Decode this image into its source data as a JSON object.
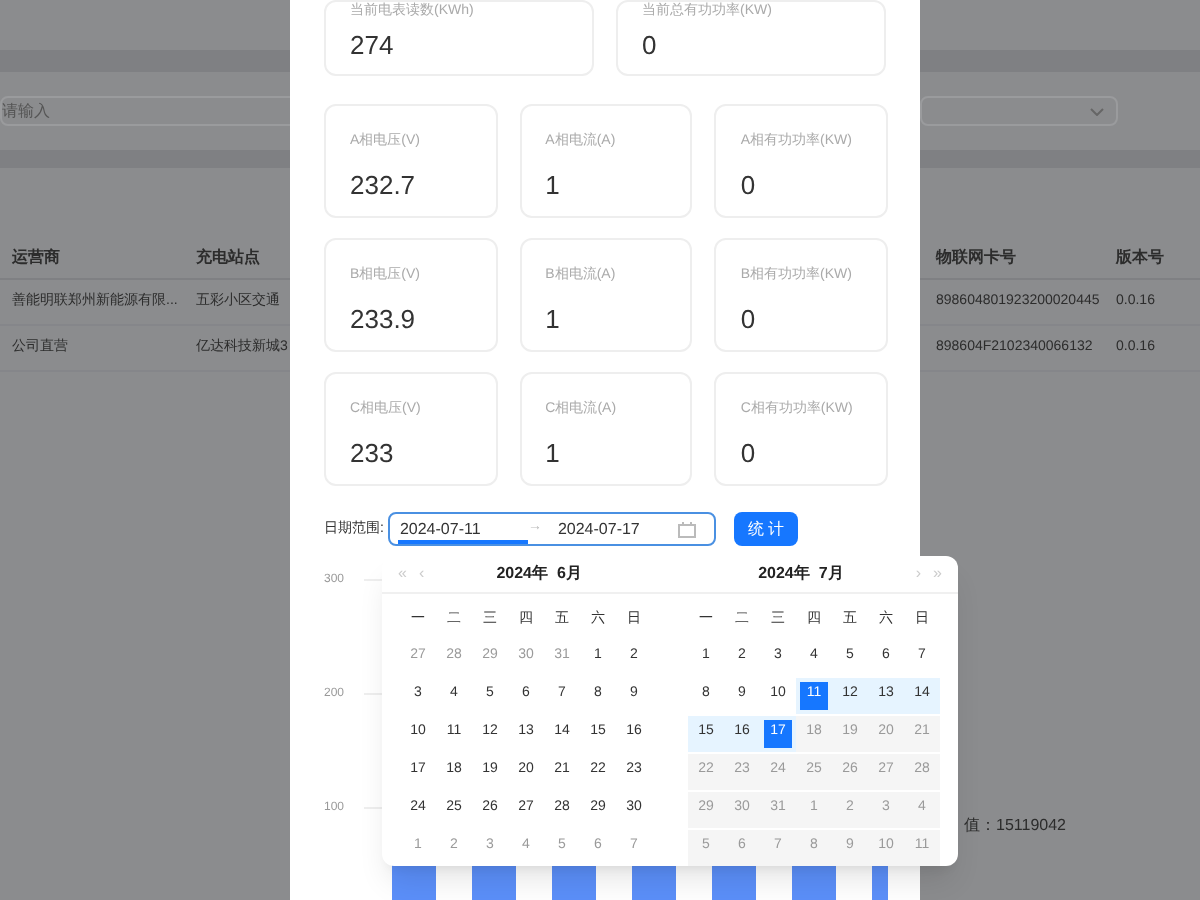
{
  "background": {
    "search_placeholder": "请输入",
    "table": {
      "columns_left": [
        "运营商",
        "充电站点"
      ],
      "columns_right": [
        "物联网卡号",
        "版本号"
      ],
      "rows": [
        {
          "operator": "善能明联郑州新能源有限...",
          "station": "五彩小区交通",
          "card": "898604801923200020445",
          "version": "0.0.16"
        },
        {
          "operator": "公司直营",
          "station": "亿达科技新城3",
          "card": "898604F2102340066132",
          "version": "0.0.16"
        }
      ]
    },
    "footer_text": "值：15119042"
  },
  "cards_top": [
    {
      "label": "当前电表读数(KWh)",
      "value": "274"
    },
    {
      "label": "当前总有功功率(KW)",
      "value": "0"
    }
  ],
  "cards": [
    {
      "label": "A相电压(V)",
      "value": "232.7"
    },
    {
      "label": "A相电流(A)",
      "value": "1"
    },
    {
      "label": "A相有功功率(KW)",
      "value": "0"
    },
    {
      "label": "B相电压(V)",
      "value": "233.9"
    },
    {
      "label": "B相电流(A)",
      "value": "1"
    },
    {
      "label": "B相有功功率(KW)",
      "value": "0"
    },
    {
      "label": "C相电压(V)",
      "value": "233"
    },
    {
      "label": "C相电流(A)",
      "value": "1"
    },
    {
      "label": "C相有功功率(KW)",
      "value": "0"
    }
  ],
  "date_range": {
    "label": "日期范围:",
    "start": "2024-07-11",
    "separator": "→",
    "end": "2024-07-17"
  },
  "stat_button": "统 计",
  "chart_axis": [
    "300",
    "200",
    "100"
  ],
  "calendar": {
    "panels": [
      {
        "title": "2024年  6月",
        "nav": [
          "«",
          "‹"
        ],
        "weekdays": [
          "一",
          "二",
          "三",
          "四",
          "五",
          "六",
          "日"
        ],
        "days": [
          {
            "day": "27",
            "outside": true,
            "selected": false,
            "in_range": false
          },
          {
            "day": "28",
            "outside": true,
            "selected": false,
            "in_range": false
          },
          {
            "day": "29",
            "outside": true,
            "selected": false,
            "in_range": false
          },
          {
            "day": "30",
            "outside": true,
            "selected": false,
            "in_range": false
          },
          {
            "day": "31",
            "outside": true,
            "selected": false,
            "in_range": false
          },
          {
            "day": "1",
            "outside": false,
            "selected": false,
            "in_range": false
          },
          {
            "day": "2",
            "outside": false,
            "selected": false,
            "in_range": false
          },
          {
            "day": "3",
            "outside": false,
            "selected": false,
            "in_range": false
          },
          {
            "day": "4",
            "outside": false,
            "selected": false,
            "in_range": false
          },
          {
            "day": "5",
            "outside": false,
            "selected": false,
            "in_range": false
          },
          {
            "day": "6",
            "outside": false,
            "selected": false,
            "in_range": false
          },
          {
            "day": "7",
            "outside": false,
            "selected": false,
            "in_range": false
          },
          {
            "day": "8",
            "outside": false,
            "selected": false,
            "in_range": false
          },
          {
            "day": "9",
            "outside": false,
            "selected": false,
            "in_range": false
          },
          {
            "day": "10",
            "outside": false,
            "selected": false,
            "in_range": false
          },
          {
            "day": "11",
            "outside": false,
            "selected": false,
            "in_range": false
          },
          {
            "day": "12",
            "outside": false,
            "selected": false,
            "in_range": false
          },
          {
            "day": "13",
            "outside": false,
            "selected": false,
            "in_range": false
          },
          {
            "day": "14",
            "outside": false,
            "selected": false,
            "in_range": false
          },
          {
            "day": "15",
            "outside": false,
            "selected": false,
            "in_range": false
          },
          {
            "day": "16",
            "outside": false,
            "selected": false,
            "in_range": false
          },
          {
            "day": "17",
            "outside": false,
            "selected": false,
            "in_range": false
          },
          {
            "day": "18",
            "outside": false,
            "selected": false,
            "in_range": false
          },
          {
            "day": "19",
            "outside": false,
            "selected": false,
            "in_range": false
          },
          {
            "day": "20",
            "outside": false,
            "selected": false,
            "in_range": false
          },
          {
            "day": "21",
            "outside": false,
            "selected": false,
            "in_range": false
          },
          {
            "day": "22",
            "outside": false,
            "selected": false,
            "in_range": false
          },
          {
            "day": "23",
            "outside": false,
            "selected": false,
            "in_range": false
          },
          {
            "day": "24",
            "outside": false,
            "selected": false,
            "in_range": false
          },
          {
            "day": "25",
            "outside": false,
            "selected": false,
            "in_range": false
          },
          {
            "day": "26",
            "outside": false,
            "selected": false,
            "in_range": false
          },
          {
            "day": "27",
            "outside": false,
            "selected": false,
            "in_range": false
          },
          {
            "day": "28",
            "outside": false,
            "selected": false,
            "in_range": false
          },
          {
            "day": "29",
            "outside": false,
            "selected": false,
            "in_range": false
          },
          {
            "day": "30",
            "outside": false,
            "selected": false,
            "in_range": false
          },
          {
            "day": "1",
            "outside": true,
            "selected": false,
            "in_range": false
          },
          {
            "day": "2",
            "outside": true,
            "selected": false,
            "in_range": false
          },
          {
            "day": "3",
            "outside": true,
            "selected": false,
            "in_range": false
          },
          {
            "day": "4",
            "outside": true,
            "selected": false,
            "in_range": false
          },
          {
            "day": "5",
            "outside": true,
            "selected": false,
            "in_range": false
          },
          {
            "day": "6",
            "outside": true,
            "selected": false,
            "in_range": false
          },
          {
            "day": "7",
            "outside": true,
            "selected": false,
            "in_range": false
          }
        ]
      },
      {
        "title": "2024年  7月",
        "nav": [
          "›",
          "»"
        ],
        "weekdays": [
          "一",
          "二",
          "三",
          "四",
          "五",
          "六",
          "日"
        ],
        "days": [
          {
            "day": "1",
            "disabled": false,
            "selected": false,
            "in_range": false
          },
          {
            "day": "2",
            "disabled": false,
            "selected": false,
            "in_range": false
          },
          {
            "day": "3",
            "disabled": false,
            "selected": false,
            "in_range": false
          },
          {
            "day": "4",
            "disabled": false,
            "selected": false,
            "in_range": false
          },
          {
            "day": "5",
            "disabled": false,
            "selected": false,
            "in_range": false
          },
          {
            "day": "6",
            "disabled": false,
            "selected": false,
            "in_range": false
          },
          {
            "day": "7",
            "disabled": false,
            "selected": false,
            "in_range": false
          },
          {
            "day": "8",
            "disabled": false,
            "selected": false,
            "in_range": false
          },
          {
            "day": "9",
            "disabled": false,
            "selected": false,
            "in_range": false
          },
          {
            "day": "10",
            "disabled": false,
            "selected": false,
            "in_range": false
          },
          {
            "day": "11",
            "disabled": false,
            "selected": true,
            "in_range": true
          },
          {
            "day": "12",
            "disabled": false,
            "selected": false,
            "in_range": true
          },
          {
            "day": "13",
            "disabled": false,
            "selected": false,
            "in_range": true
          },
          {
            "day": "14",
            "disabled": false,
            "selected": false,
            "in_range": true
          },
          {
            "day": "15",
            "disabled": false,
            "selected": false,
            "in_range": true
          },
          {
            "day": "16",
            "disabled": false,
            "selected": false,
            "in_range": true
          },
          {
            "day": "17",
            "disabled": false,
            "selected": true,
            "in_range": true
          },
          {
            "day": "18",
            "disabled": true,
            "selected": false,
            "in_range": false
          },
          {
            "day": "19",
            "disabled": true,
            "selected": false,
            "in_range": false
          },
          {
            "day": "20",
            "disabled": true,
            "selected": false,
            "in_range": false
          },
          {
            "day": "21",
            "disabled": true,
            "selected": false,
            "in_range": false
          },
          {
            "day": "22",
            "disabled": true,
            "selected": false,
            "in_range": false
          },
          {
            "day": "23",
            "disabled": true,
            "selected": false,
            "in_range": false
          },
          {
            "day": "24",
            "disabled": true,
            "selected": false,
            "in_range": false
          },
          {
            "day": "25",
            "disabled": true,
            "selected": false,
            "in_range": false
          },
          {
            "day": "26",
            "disabled": true,
            "selected": false,
            "in_range": false
          },
          {
            "day": "27",
            "disabled": true,
            "selected": false,
            "in_range": false
          },
          {
            "day": "28",
            "disabled": true,
            "selected": false,
            "in_range": false
          },
          {
            "day": "29",
            "disabled": true,
            "selected": false,
            "in_range": false
          },
          {
            "day": "30",
            "disabled": true,
            "selected": false,
            "in_range": false
          },
          {
            "day": "31",
            "disabled": true,
            "selected": false,
            "in_range": false
          },
          {
            "day": "1",
            "disabled": true,
            "selected": false,
            "in_range": false
          },
          {
            "day": "2",
            "disabled": true,
            "selected": false,
            "in_range": false
          },
          {
            "day": "3",
            "disabled": true,
            "selected": false,
            "in_range": false
          },
          {
            "day": "4",
            "disabled": true,
            "selected": false,
            "in_range": false
          },
          {
            "day": "5",
            "disabled": true,
            "selected": false,
            "in_range": false
          },
          {
            "day": "6",
            "disabled": true,
            "selected": false,
            "in_range": false
          },
          {
            "day": "7",
            "disabled": true,
            "selected": false,
            "in_range": false
          },
          {
            "day": "8",
            "disabled": true,
            "selected": false,
            "in_range": false
          },
          {
            "day": "9",
            "disabled": true,
            "selected": false,
            "in_range": false
          },
          {
            "day": "10",
            "disabled": true,
            "selected": false,
            "in_range": false
          },
          {
            "day": "11",
            "disabled": true,
            "selected": false,
            "in_range": false
          }
        ]
      }
    ]
  }
}
